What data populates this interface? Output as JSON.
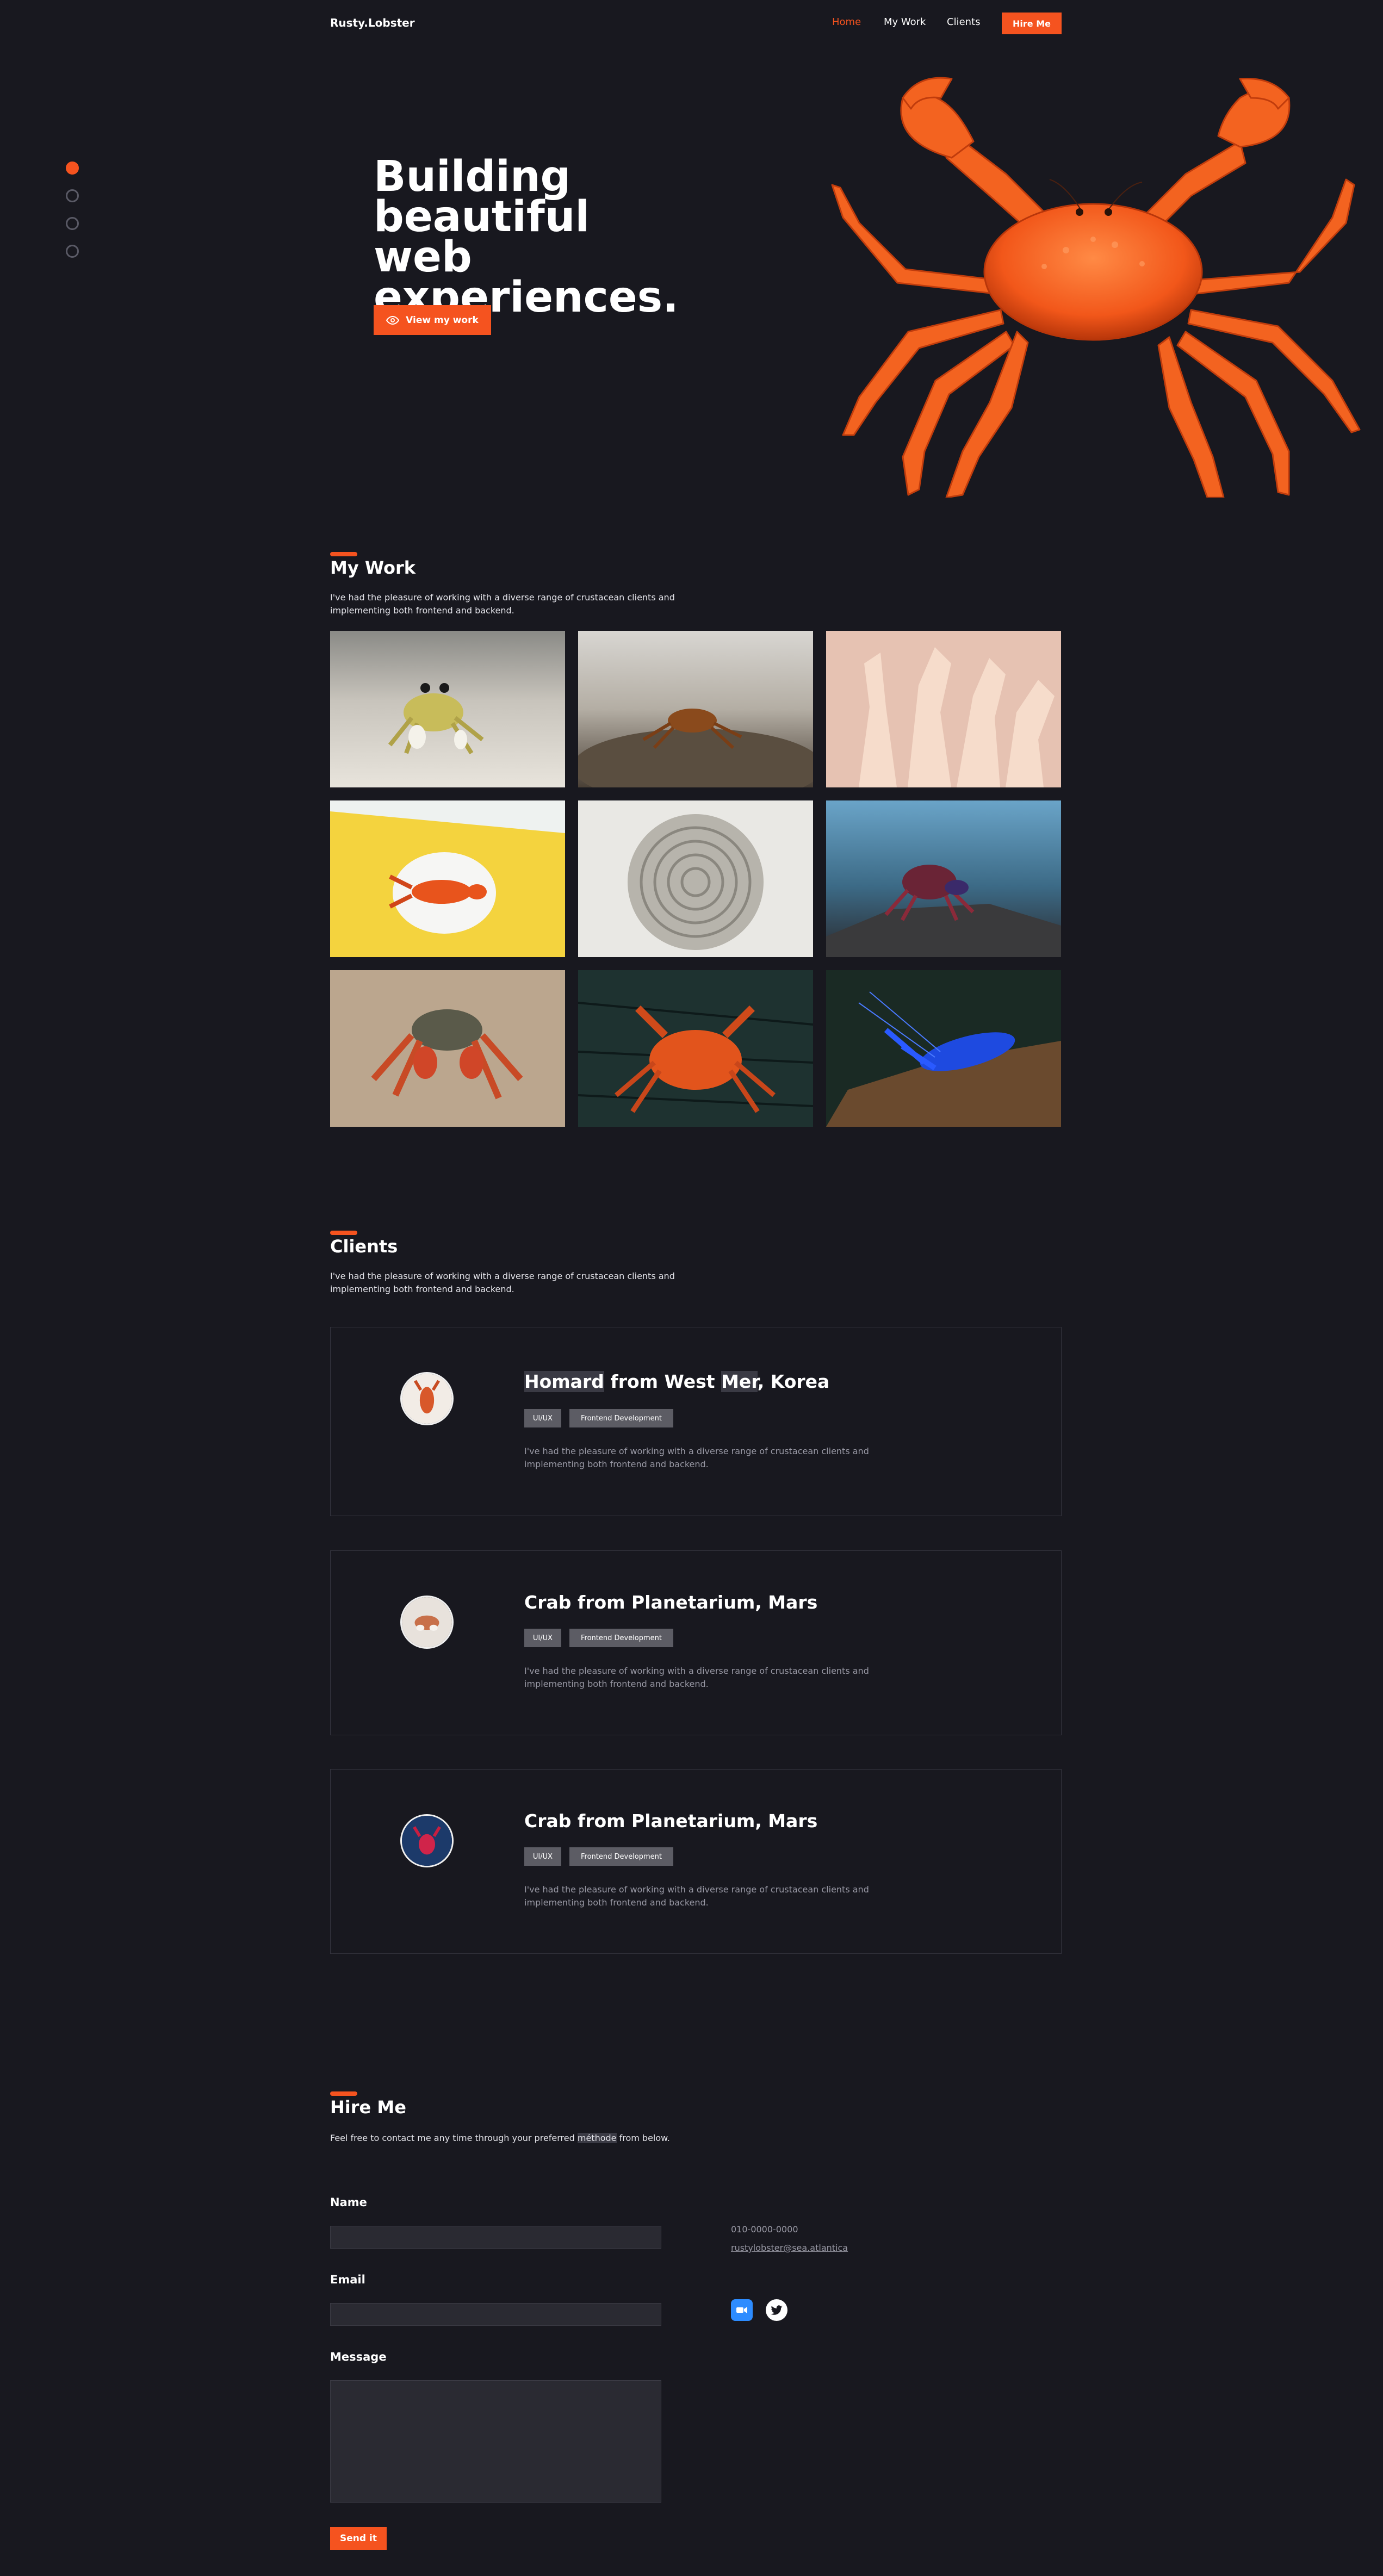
{
  "header": {
    "brand": "Rusty.Lobster",
    "nav": [
      {
        "label": "Home",
        "active": true
      },
      {
        "label": "My Work",
        "active": false
      },
      {
        "label": "Clients",
        "active": false
      }
    ],
    "hire_label": "Hire Me"
  },
  "side_nav": {
    "dots": 4,
    "active_index": 0
  },
  "hero": {
    "title_lines": [
      "Building",
      "beautiful web",
      "experiences."
    ],
    "cta_label": "View my work",
    "cta_icon": "eye-icon"
  },
  "work": {
    "title": "My Work",
    "description": "I've had the pleasure of working with a diverse range of crustacean clients and implementing both frontend and backend.",
    "gallery": [
      {
        "subject": "ghost crab on sand"
      },
      {
        "subject": "small crab on rock"
      },
      {
        "subject": "pale coral"
      },
      {
        "subject": "lobster on plate, yellow background"
      },
      {
        "subject": "round brain coral"
      },
      {
        "subject": "red-purple crab on rock"
      },
      {
        "subject": "red crab on beach"
      },
      {
        "subject": "orange crab on dark wood"
      },
      {
        "subject": "blue crayfish on log"
      }
    ]
  },
  "clients": {
    "title": "Clients",
    "description": "I've had the pleasure of working with a diverse range of crustacean clients and implementing both frontend and backend.",
    "items": [
      {
        "name_parts": [
          {
            "text": "Homard",
            "hl": true
          },
          {
            "text": " from West ",
            "hl": false
          },
          {
            "text": "Mer",
            "hl": true
          },
          {
            "text": ", Korea",
            "hl": false
          }
        ],
        "tags": [
          "UI/UX",
          "Frontend Development"
        ],
        "description": "I've had the pleasure of working with a diverse range of crustacean clients and implementing both frontend and backend."
      },
      {
        "name_parts": [
          {
            "text": "Crab from Planetarium, Mars",
            "hl": false
          }
        ],
        "tags": [
          "UI/UX",
          "Frontend Development"
        ],
        "description": "I've had the pleasure of working with a diverse range of crustacean clients and implementing both frontend and backend."
      },
      {
        "name_parts": [
          {
            "text": "Crab from Planetarium, Mars",
            "hl": false
          }
        ],
        "tags": [
          "UI/UX",
          "Frontend Development"
        ],
        "description": "I've had the pleasure of working with a diverse range of crustacean clients and implementing both frontend and backend."
      }
    ]
  },
  "hire": {
    "title": "Hire Me",
    "intro_parts": [
      {
        "text": "Feel free to contact me any time through your preferred ",
        "hl": false
      },
      {
        "text": "méthode",
        "hl": true
      },
      {
        "text": " from below.",
        "hl": false
      }
    ],
    "form": {
      "name_label": "Name",
      "email_label": "Email",
      "message_label": "Message",
      "submit_label": "Send it"
    },
    "contact": {
      "phone": "010-0000-0000",
      "email": "rustylobster@sea.atlantica"
    },
    "social": [
      {
        "name": "zoom-icon",
        "color": "#2d8cff"
      },
      {
        "name": "twitter-icon",
        "color": "#ffffff"
      }
    ]
  },
  "colors": {
    "accent": "#f5531f",
    "background": "#18181f",
    "card_border": "#34343e"
  }
}
